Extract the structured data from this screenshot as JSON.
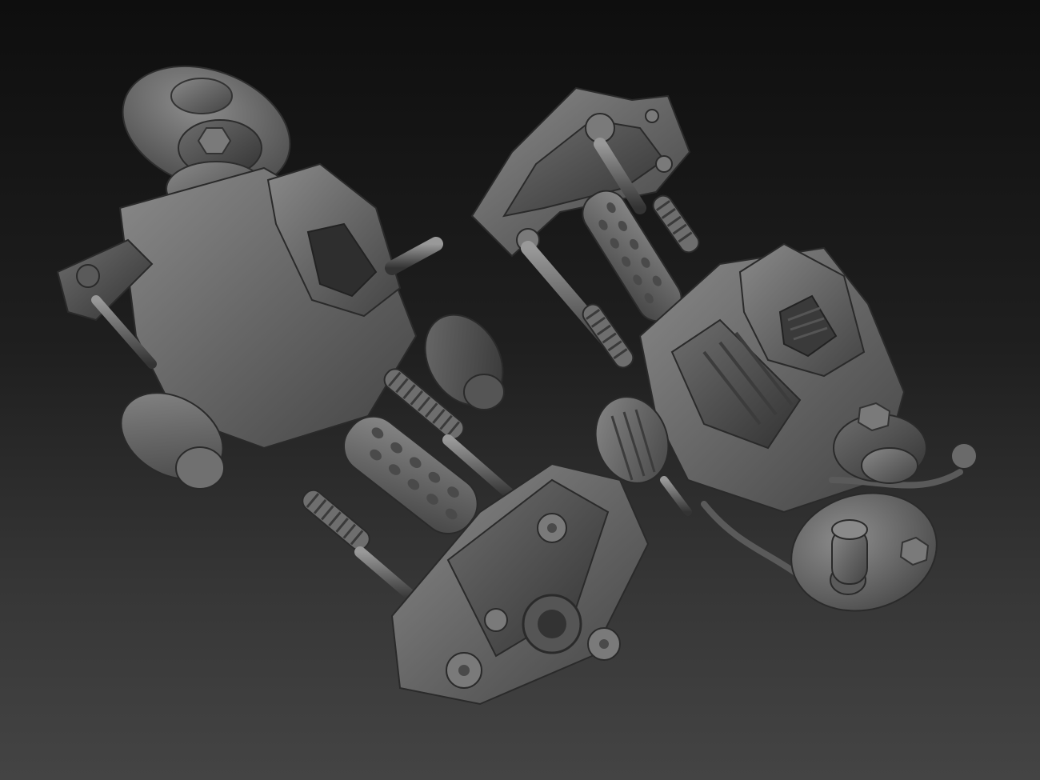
{
  "scene": {
    "background_top": "#0e0e0e",
    "background_bottom": "#444444",
    "material_base": "#6a6a6a",
    "material_light": "#8c8c8c",
    "material_dark": "#3a3a3a",
    "objects": [
      {
        "id": "left-gun"
      },
      {
        "id": "right-gun"
      }
    ]
  }
}
